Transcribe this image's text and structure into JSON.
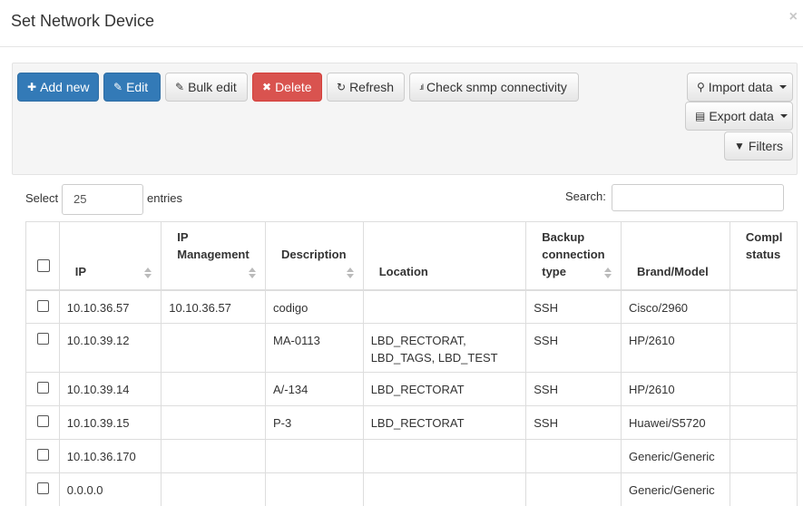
{
  "dialog": {
    "title": "Set Network Device",
    "close_glyph": "×"
  },
  "toolbar": {
    "add_new": "Add new",
    "edit": "Edit",
    "bulk_edit": "Bulk edit",
    "delete": "Delete",
    "refresh": "Refresh",
    "check_snmp": "Check snmp connectivity",
    "import_data": "Import data",
    "export_data": "Export data",
    "filters": "Filters"
  },
  "entries": {
    "select_label": "Select",
    "value": "25",
    "suffix": "entries"
  },
  "search": {
    "label": "Search:",
    "value": ""
  },
  "table": {
    "headers": {
      "ip": "IP",
      "ip_management_1": "IP",
      "ip_management_2": "Management",
      "description": "Description",
      "location": "Location",
      "backup_1": "Backup",
      "backup_2": "connection",
      "backup_3": "type",
      "brand_model": "Brand/Model",
      "compliance_1": "Compl",
      "compliance_2": "status"
    },
    "rows": [
      {
        "ip": "10.10.36.57",
        "ip_management": "10.10.36.57",
        "description": "codigo",
        "location_1": "",
        "location_2": "",
        "backup": "SSH",
        "brand_model": "Cisco/2960"
      },
      {
        "ip": "10.10.39.12",
        "ip_management": "",
        "description": "MA-0113",
        "location_1": "LBD_RECTORAT,",
        "location_2": "LBD_TAGS, LBD_TEST",
        "backup": "SSH",
        "brand_model": "HP/2610"
      },
      {
        "ip": "10.10.39.14",
        "ip_management": "",
        "description": "A/-134",
        "location_1": "LBD_RECTORAT",
        "location_2": "",
        "backup": "SSH",
        "brand_model": "HP/2610"
      },
      {
        "ip": "10.10.39.15",
        "ip_management": "",
        "description": "P-3",
        "location_1": "LBD_RECTORAT",
        "location_2": "",
        "backup": "SSH",
        "brand_model": "Huawei/S5720"
      },
      {
        "ip": "10.10.36.170",
        "ip_management": "",
        "description": "",
        "location_1": "",
        "location_2": "",
        "backup": "",
        "brand_model": "Generic/Generic"
      },
      {
        "ip": "0.0.0.0",
        "ip_management": "",
        "description": "",
        "location_1": "",
        "location_2": "",
        "backup": "",
        "brand_model": "Generic/Generic"
      }
    ]
  },
  "icons": {
    "plus": "plus-icon",
    "pencil": "pencil-icon",
    "trash": "times-icon",
    "refresh": "refresh-icon",
    "signal": "signal-icon",
    "paperclip": "paperclip-icon",
    "file": "file-icon",
    "filter": "filter-icon"
  },
  "colors": {
    "primary": "#337ab7",
    "danger": "#d9534f",
    "toolbar_bg": "#f5f5f5"
  }
}
